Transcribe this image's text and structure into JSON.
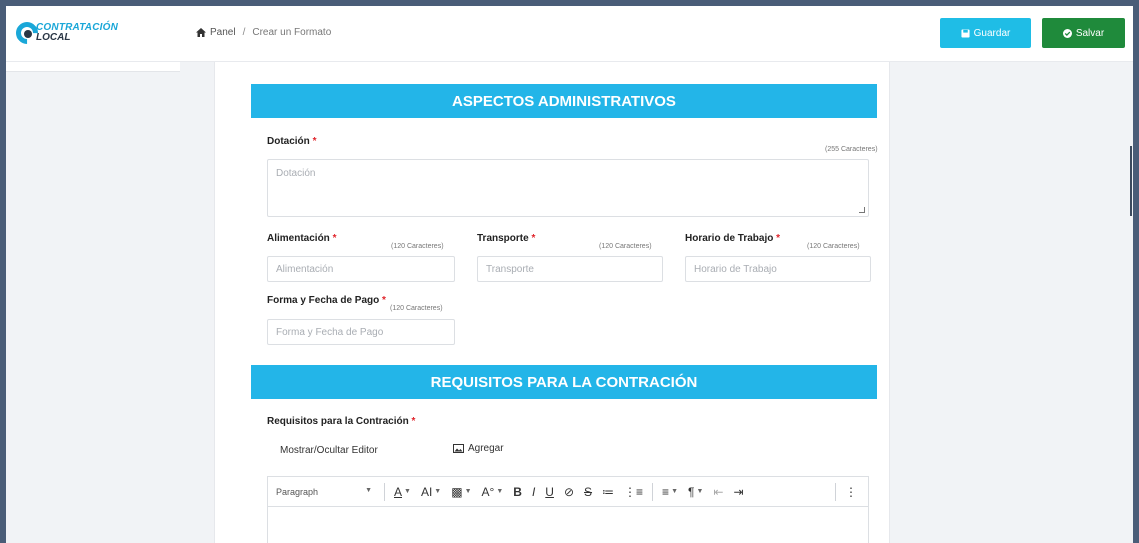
{
  "logo": {
    "line1": "CONTRATACIÓN",
    "line2": "LOCAL"
  },
  "breadcrumb": {
    "home": "Panel",
    "separator": "/",
    "current": "Crear un Formato"
  },
  "toolbar_buttons": {
    "guardar": "Guardar",
    "salvar": "Salvar"
  },
  "colors": {
    "accent": "#23b5e8",
    "guardar": "#1fbde6",
    "salvar": "#1f8a3b",
    "required": "#e0242b"
  },
  "section1": {
    "title": "ASPECTOS ADMINISTRATIVOS",
    "dotacion": {
      "label": "Dotación",
      "counter": "(255 Caracteres)",
      "placeholder": "Dotación",
      "value": ""
    },
    "alimentacion": {
      "label": "Alimentación",
      "counter": "(120 Caracteres)",
      "placeholder": "Alimentación",
      "value": ""
    },
    "transporte": {
      "label": "Transporte",
      "counter": "(120 Caracteres)",
      "placeholder": "Transporte",
      "value": ""
    },
    "horario": {
      "label": "Horario de Trabajo",
      "counter": "(120 Caracteres)",
      "placeholder": "Horario de Trabajo",
      "value": ""
    },
    "forma_pago": {
      "label": "Forma y Fecha de Pago",
      "counter": "(120 Caracteres)",
      "placeholder": "Forma y Fecha de Pago",
      "value": ""
    },
    "required_mark": "*"
  },
  "section2": {
    "title": "REQUISITOS PARA LA CONTRACIÓN",
    "requisitos_label": "Requisitos para la Contración",
    "toggle_editor": "Mostrar/Ocultar Editor",
    "add_image": "Agregar",
    "editor": {
      "paragraph": "Paragraph",
      "tools": [
        "A",
        "AI",
        "▩",
        "A°",
        "B",
        "I",
        "U",
        "⊘",
        "S",
        "≔",
        "⋮≡",
        "≡",
        "¶",
        "⇤",
        "⇥",
        "⋮"
      ]
    }
  }
}
